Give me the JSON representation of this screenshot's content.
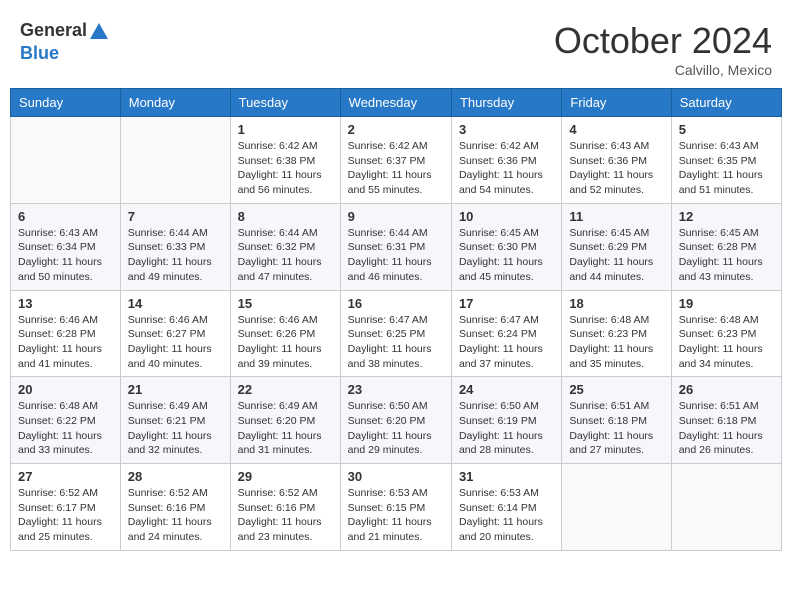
{
  "header": {
    "logo_general": "General",
    "logo_blue": "Blue",
    "month_title": "October 2024",
    "location": "Calvillo, Mexico"
  },
  "days_of_week": [
    "Sunday",
    "Monday",
    "Tuesday",
    "Wednesday",
    "Thursday",
    "Friday",
    "Saturday"
  ],
  "weeks": [
    [
      {
        "day": "",
        "info": ""
      },
      {
        "day": "",
        "info": ""
      },
      {
        "day": "1",
        "info": "Sunrise: 6:42 AM\nSunset: 6:38 PM\nDaylight: 11 hours and 56 minutes."
      },
      {
        "day": "2",
        "info": "Sunrise: 6:42 AM\nSunset: 6:37 PM\nDaylight: 11 hours and 55 minutes."
      },
      {
        "day": "3",
        "info": "Sunrise: 6:42 AM\nSunset: 6:36 PM\nDaylight: 11 hours and 54 minutes."
      },
      {
        "day": "4",
        "info": "Sunrise: 6:43 AM\nSunset: 6:36 PM\nDaylight: 11 hours and 52 minutes."
      },
      {
        "day": "5",
        "info": "Sunrise: 6:43 AM\nSunset: 6:35 PM\nDaylight: 11 hours and 51 minutes."
      }
    ],
    [
      {
        "day": "6",
        "info": "Sunrise: 6:43 AM\nSunset: 6:34 PM\nDaylight: 11 hours and 50 minutes."
      },
      {
        "day": "7",
        "info": "Sunrise: 6:44 AM\nSunset: 6:33 PM\nDaylight: 11 hours and 49 minutes."
      },
      {
        "day": "8",
        "info": "Sunrise: 6:44 AM\nSunset: 6:32 PM\nDaylight: 11 hours and 47 minutes."
      },
      {
        "day": "9",
        "info": "Sunrise: 6:44 AM\nSunset: 6:31 PM\nDaylight: 11 hours and 46 minutes."
      },
      {
        "day": "10",
        "info": "Sunrise: 6:45 AM\nSunset: 6:30 PM\nDaylight: 11 hours and 45 minutes."
      },
      {
        "day": "11",
        "info": "Sunrise: 6:45 AM\nSunset: 6:29 PM\nDaylight: 11 hours and 44 minutes."
      },
      {
        "day": "12",
        "info": "Sunrise: 6:45 AM\nSunset: 6:28 PM\nDaylight: 11 hours and 43 minutes."
      }
    ],
    [
      {
        "day": "13",
        "info": "Sunrise: 6:46 AM\nSunset: 6:28 PM\nDaylight: 11 hours and 41 minutes."
      },
      {
        "day": "14",
        "info": "Sunrise: 6:46 AM\nSunset: 6:27 PM\nDaylight: 11 hours and 40 minutes."
      },
      {
        "day": "15",
        "info": "Sunrise: 6:46 AM\nSunset: 6:26 PM\nDaylight: 11 hours and 39 minutes."
      },
      {
        "day": "16",
        "info": "Sunrise: 6:47 AM\nSunset: 6:25 PM\nDaylight: 11 hours and 38 minutes."
      },
      {
        "day": "17",
        "info": "Sunrise: 6:47 AM\nSunset: 6:24 PM\nDaylight: 11 hours and 37 minutes."
      },
      {
        "day": "18",
        "info": "Sunrise: 6:48 AM\nSunset: 6:23 PM\nDaylight: 11 hours and 35 minutes."
      },
      {
        "day": "19",
        "info": "Sunrise: 6:48 AM\nSunset: 6:23 PM\nDaylight: 11 hours and 34 minutes."
      }
    ],
    [
      {
        "day": "20",
        "info": "Sunrise: 6:48 AM\nSunset: 6:22 PM\nDaylight: 11 hours and 33 minutes."
      },
      {
        "day": "21",
        "info": "Sunrise: 6:49 AM\nSunset: 6:21 PM\nDaylight: 11 hours and 32 minutes."
      },
      {
        "day": "22",
        "info": "Sunrise: 6:49 AM\nSunset: 6:20 PM\nDaylight: 11 hours and 31 minutes."
      },
      {
        "day": "23",
        "info": "Sunrise: 6:50 AM\nSunset: 6:20 PM\nDaylight: 11 hours and 29 minutes."
      },
      {
        "day": "24",
        "info": "Sunrise: 6:50 AM\nSunset: 6:19 PM\nDaylight: 11 hours and 28 minutes."
      },
      {
        "day": "25",
        "info": "Sunrise: 6:51 AM\nSunset: 6:18 PM\nDaylight: 11 hours and 27 minutes."
      },
      {
        "day": "26",
        "info": "Sunrise: 6:51 AM\nSunset: 6:18 PM\nDaylight: 11 hours and 26 minutes."
      }
    ],
    [
      {
        "day": "27",
        "info": "Sunrise: 6:52 AM\nSunset: 6:17 PM\nDaylight: 11 hours and 25 minutes."
      },
      {
        "day": "28",
        "info": "Sunrise: 6:52 AM\nSunset: 6:16 PM\nDaylight: 11 hours and 24 minutes."
      },
      {
        "day": "29",
        "info": "Sunrise: 6:52 AM\nSunset: 6:16 PM\nDaylight: 11 hours and 23 minutes."
      },
      {
        "day": "30",
        "info": "Sunrise: 6:53 AM\nSunset: 6:15 PM\nDaylight: 11 hours and 21 minutes."
      },
      {
        "day": "31",
        "info": "Sunrise: 6:53 AM\nSunset: 6:14 PM\nDaylight: 11 hours and 20 minutes."
      },
      {
        "day": "",
        "info": ""
      },
      {
        "day": "",
        "info": ""
      }
    ]
  ]
}
